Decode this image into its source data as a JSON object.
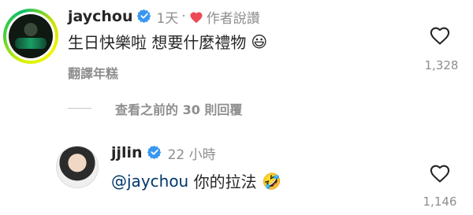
{
  "comment": {
    "username": "jaychou",
    "time": "1天",
    "separator": "·",
    "author_liked": "作者說讚",
    "text": "生日快樂啦 想要什麼禮物",
    "emoji": "😃",
    "translate": "翻譯年糕",
    "like_count": "1,328"
  },
  "view_replies": "查看之前的 30 則回覆",
  "reply": {
    "username": "jjlin",
    "time": "22 小時",
    "mention": "@jaychou",
    "text": " 你的拉法 ",
    "emoji": "🤣",
    "like_count": "1,146"
  },
  "colors": {
    "verified": "#3897f0",
    "heart_red": "#ed4956",
    "text": "#262626",
    "secondary": "#8e8e8e",
    "mention": "#00376b"
  },
  "icons": {
    "verified": "verified-badge-icon",
    "liked_by_author": "heart-filled-icon",
    "like": "heart-outline-icon"
  }
}
